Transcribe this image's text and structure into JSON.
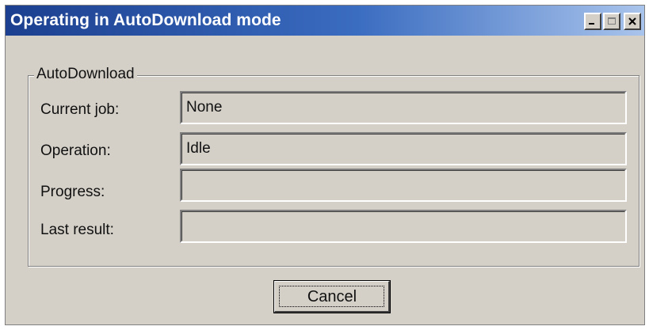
{
  "window": {
    "title": "Operating in AutoDownload mode",
    "controls": {
      "minimize_icon": "minimize-icon",
      "maximize_icon": "maximize-icon",
      "close_icon": "close-icon"
    },
    "titlebar_colors": [
      "#1c3f8f",
      "#3a6cc0",
      "#a9c4ec"
    ],
    "background_color": "#d4d0c8"
  },
  "group": {
    "label": "AutoDownload",
    "fields": [
      {
        "label": "Current job:",
        "value": "None"
      },
      {
        "label": "Operation:",
        "value": "Idle"
      },
      {
        "label": "Progress:",
        "value": ""
      },
      {
        "label": "Last result:",
        "value": ""
      }
    ]
  },
  "buttons": {
    "cancel_label": "Cancel"
  }
}
